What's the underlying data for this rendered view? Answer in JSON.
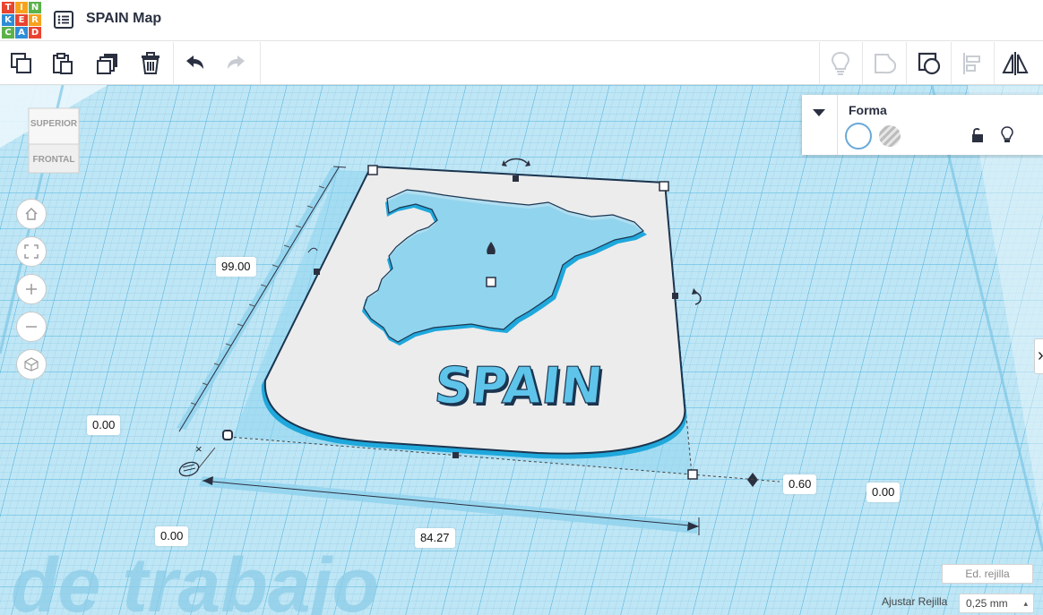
{
  "app": {
    "logo_letters": [
      "T",
      "I",
      "N",
      "K",
      "E",
      "R",
      "C",
      "A",
      "D"
    ],
    "title": "SPAIN Map"
  },
  "toolbar": {
    "buttons": [
      "copy-icon",
      "paste-icon",
      "duplicate-icon",
      "delete-icon",
      "undo-icon",
      "redo-icon"
    ],
    "right_buttons": [
      "light-icon",
      "group-shape-icon",
      "ungroup-icon",
      "align-icon",
      "mirror-icon"
    ]
  },
  "viewcube": {
    "top_label": "SUPERIOR",
    "front_label": "FRONTAL"
  },
  "nav_buttons": [
    "home-icon",
    "fit-icon",
    "zoom-in-icon",
    "zoom-out-icon",
    "perspective-icon"
  ],
  "shape_panel": {
    "title": "Forma"
  },
  "object": {
    "embossed_text": "SPAIN"
  },
  "dimensions": {
    "height": "99.00",
    "left_offset": "0.00",
    "bottom_offset": "0.00",
    "width": "84.27",
    "thickness": "0.60",
    "right_offset": "0.00"
  },
  "workplane": {
    "watermark": "de trabajo",
    "edit_grid": "Ed. rejilla",
    "snap_label": "Ajustar Rejilla",
    "snap_value": "0,25 mm"
  },
  "colors": {
    "accent": "#1fa8dc",
    "grid_bg": "#bfe6f5",
    "plate": "#ececec",
    "tinkercad_red": "#e9442f"
  }
}
